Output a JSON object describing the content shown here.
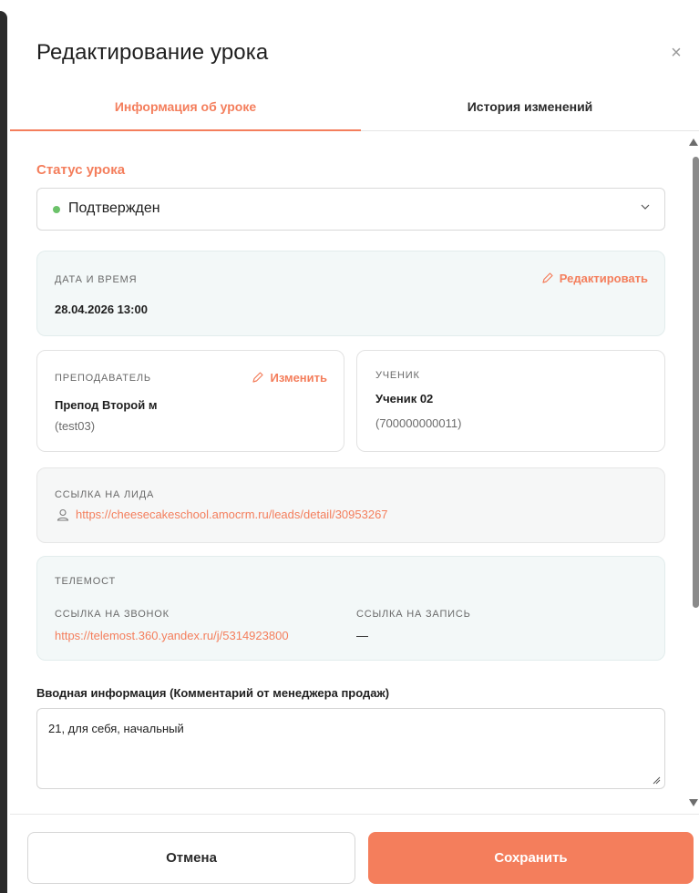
{
  "modal": {
    "title": "Редактирование урока",
    "close_symbol": "×"
  },
  "tabs": [
    {
      "label": "Информация об уроке",
      "active": true
    },
    {
      "label": "История изменений",
      "active": false
    }
  ],
  "status": {
    "label": "Статус урока",
    "value": "Подтвержден",
    "dot_color": "#6cc26a"
  },
  "datetime": {
    "caption": "Дата и время",
    "value": "28.04.2026 13:00",
    "edit_label": "Редактировать"
  },
  "teacher": {
    "caption": "Преподаватель",
    "name": "Препод Второй м",
    "login": "(test03)",
    "change_label": "Изменить"
  },
  "student": {
    "caption": "Ученик",
    "name": "Ученик 02",
    "phone": "(700000000011)"
  },
  "lead": {
    "caption": "Ссылка на лида",
    "url": "https://cheesecakeschool.amocrm.ru/leads/detail/30953267",
    "icon": "user-icon"
  },
  "telemost": {
    "caption": "Телемост",
    "call_caption": "Ссылка на звонок",
    "call_url": "https://telemost.360.yandex.ru/j/5314923800",
    "record_caption": "Ссылка на запись",
    "record_value": "—"
  },
  "intro": {
    "label": "Вводная информация (Комментарий от менеджера продаж)",
    "value": "21, для себя, начальный"
  },
  "footer": {
    "cancel_label": "Отмена",
    "save_label": "Сохранить"
  },
  "colors": {
    "accent": "#f47e5c",
    "status_green": "#6cc26a",
    "card_tint": "#f3f8f8"
  }
}
